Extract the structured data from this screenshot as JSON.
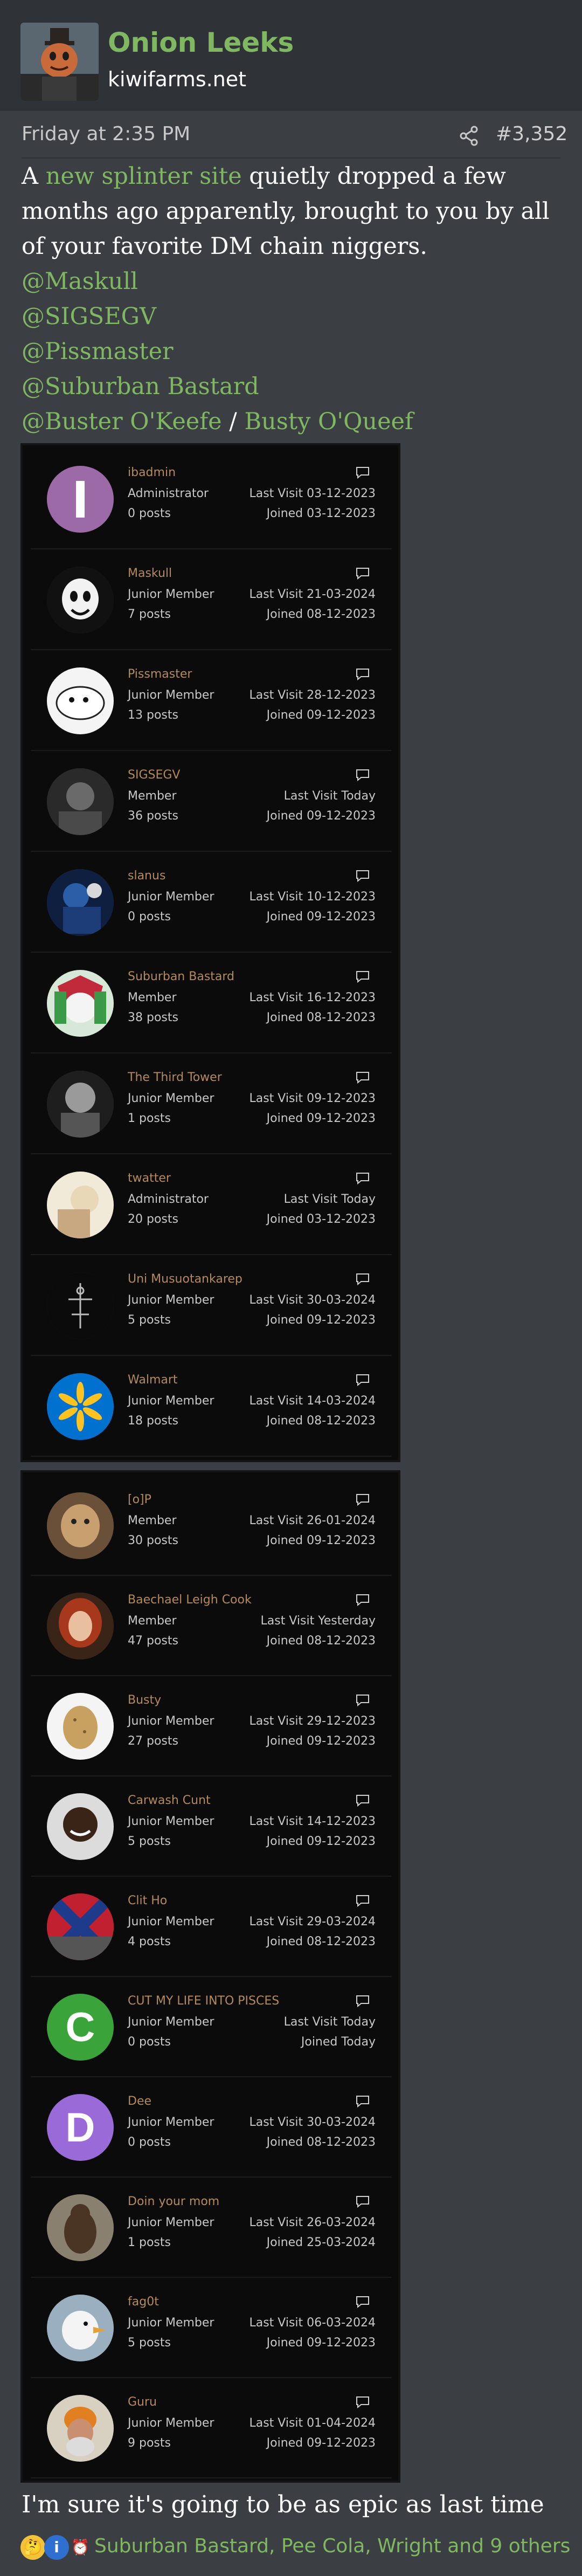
{
  "header": {
    "username": "Onion Leeks",
    "site": "kiwifarms.net"
  },
  "post": {
    "time": "Friday at 2:35 PM",
    "number": "#3,352",
    "intro_a": "A ",
    "intro_link": "new splinter site",
    "intro_b": " quietly dropped a few months ago apparently, brought to you by all of your favorite DM chain niggers.",
    "mentions": [
      "@Maskull",
      "@SIGSEGV",
      "@Pissmaster",
      "@Suburban Bastard"
    ],
    "mention_last_a": "@Buster O'Keefe",
    "mention_sep": " / ",
    "mention_last_b": "Busty O'Queef",
    "closing": "I'm sure it's going to be as epic as last time"
  },
  "screenshot1": {
    "members": [
      {
        "name": "ibadmin",
        "role": "Administrator",
        "posts": "0 posts",
        "last": "Last Visit 03-12-2023",
        "joined": "Joined 03-12-2023",
        "avatar": "letter-I"
      },
      {
        "name": "Maskull",
        "role": "Junior Member",
        "posts": "7 posts",
        "last": "Last Visit 21-03-2024",
        "joined": "Joined 08-12-2023",
        "avatar": "mask"
      },
      {
        "name": "Pissmaster",
        "role": "Junior Member",
        "posts": "13 posts",
        "last": "Last Visit 28-12-2023",
        "joined": "Joined 09-12-2023",
        "avatar": "sketch"
      },
      {
        "name": "SIGSEGV",
        "role": "Member",
        "posts": "36 posts",
        "last": "Last Visit Today",
        "joined": "Joined 09-12-2023",
        "avatar": "photo-gray"
      },
      {
        "name": "slanus",
        "role": "Junior Member",
        "posts": "0 posts",
        "last": "Last Visit 10-12-2023",
        "joined": "Joined 09-12-2023",
        "avatar": "photo-blue"
      },
      {
        "name": "Suburban Bastard",
        "role": "Member",
        "posts": "38 posts",
        "last": "Last Visit 16-12-2023",
        "joined": "Joined 08-12-2023",
        "avatar": "cartoon"
      },
      {
        "name": "The Third Tower",
        "role": "Junior Member",
        "posts": "1 posts",
        "last": "Last Visit 09-12-2023",
        "joined": "Joined 09-12-2023",
        "avatar": "photo-bw"
      },
      {
        "name": "twatter",
        "role": "Administrator",
        "posts": "20 posts",
        "last": "Last Visit Today",
        "joined": "Joined 03-12-2023",
        "avatar": "photo-cream"
      },
      {
        "name": "Uni Musuotankarep",
        "role": "Junior Member",
        "posts": "5 posts",
        "last": "Last Visit 30-03-2024",
        "joined": "Joined 09-12-2023",
        "avatar": "symbol"
      },
      {
        "name": "Walmart",
        "role": "Junior Member",
        "posts": "18 posts",
        "last": "Last Visit 14-03-2024",
        "joined": "Joined 08-12-2023",
        "avatar": "walmart"
      }
    ]
  },
  "screenshot2": {
    "members": [
      {
        "name": "[o]P",
        "role": "Member",
        "posts": "30 posts",
        "last": "Last Visit 26-01-2024",
        "joined": "Joined 09-12-2023",
        "avatar": "photo-tan"
      },
      {
        "name": "Baechael Leigh Cook",
        "role": "Member",
        "posts": "47 posts",
        "last": "Last Visit Yesterday",
        "joined": "Joined 08-12-2023",
        "avatar": "photo-red"
      },
      {
        "name": "Busty",
        "role": "Junior Member",
        "posts": "27 posts",
        "last": "Last Visit 29-12-2023",
        "joined": "Joined 09-12-2023",
        "avatar": "potato"
      },
      {
        "name": "Carwash Cunt",
        "role": "Junior Member",
        "posts": "5 posts",
        "last": "Last Visit 14-12-2023",
        "joined": "Joined 09-12-2023",
        "avatar": "photo-dark"
      },
      {
        "name": "Clit Ho",
        "role": "Junior Member",
        "posts": "4 posts",
        "last": "Last Visit 29-03-2024",
        "joined": "Joined 08-12-2023",
        "avatar": "flag"
      },
      {
        "name": "CUT MY LIFE INTO PISCES",
        "role": "Junior Member",
        "posts": "0 posts",
        "last": "Last Visit Today",
        "joined": "Joined Today",
        "avatar": "letter-C"
      },
      {
        "name": "Dee",
        "role": "Junior Member",
        "posts": "0 posts",
        "last": "Last Visit 30-03-2024",
        "joined": "Joined 08-12-2023",
        "avatar": "letter-D"
      },
      {
        "name": "Doin your mom",
        "role": "Junior Member",
        "posts": "1 posts",
        "last": "Last Visit 26-03-2024",
        "joined": "Joined 25-03-2024",
        "avatar": "bear"
      },
      {
        "name": "fag0t",
        "role": "Junior Member",
        "posts": "5 posts",
        "last": "Last Visit 06-03-2024",
        "joined": "Joined 09-12-2023",
        "avatar": "duck"
      },
      {
        "name": "Guru",
        "role": "Junior Member",
        "posts": "9 posts",
        "last": "Last Visit 01-04-2024",
        "joined": "Joined 09-12-2023",
        "avatar": "guru"
      }
    ]
  },
  "reactions": {
    "icons": [
      "thinking-face-icon",
      "informative-icon",
      "alarm-clock-icon"
    ],
    "names": "Suburban Bastard, Pee Cola, Wright and 9 others"
  },
  "colors": {
    "accent_green": "#7fb860",
    "member_name": "#b58a5a",
    "background": "#3b3f44",
    "header_bg": "#2f3237"
  }
}
